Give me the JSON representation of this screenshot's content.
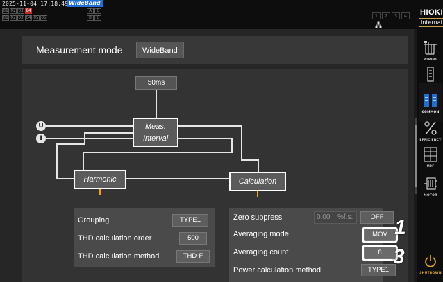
{
  "status_bar": {
    "datetime": "2025-11-04 17:18:49",
    "mode_badge": "WideBand",
    "indicators_row1": [
      "01",
      "02",
      "03",
      "04"
    ],
    "indicators_row2": [
      "01",
      "02",
      "03",
      "04",
      "05",
      "06"
    ],
    "ac_row1": [
      "A",
      "C"
    ],
    "ac_row2": [
      "D",
      "C"
    ],
    "channel_numbers": [
      "1",
      "2",
      "3",
      "4"
    ],
    "alert_color": "#c62828"
  },
  "sidebar": {
    "brand": "HIOKI",
    "source_label": "Internal",
    "items": [
      {
        "label": "WIRING",
        "icon": "wiring-icon"
      },
      {
        "label": "CHANNEL",
        "icon": "channel-icon"
      },
      {
        "label": "COMMON",
        "icon": "common-icon",
        "active": true
      },
      {
        "label": "EFFICIENCY",
        "icon": "efficiency-icon"
      },
      {
        "label": "UDF",
        "icon": "udf-icon"
      },
      {
        "label": "MOTOR",
        "icon": "motor-icon"
      },
      {
        "label": "SHUTDOWN",
        "icon": "shutdown-icon"
      }
    ]
  },
  "measurement_mode": {
    "label": "Measurement mode",
    "value": "WideBand"
  },
  "diagram": {
    "interval_value": "50ms",
    "meas_interval": [
      "Meas.",
      "Interval"
    ],
    "inputs": [
      "U",
      "I"
    ],
    "harmonic_label": "Harmonic",
    "calculation_label": "Calculation",
    "line_color": "#e6e6e6",
    "tick_color": "#f0a030"
  },
  "harmonic_settings": {
    "grouping": {
      "label": "Grouping",
      "value": "TYPE1"
    },
    "thd_order": {
      "label": "THD calculation order",
      "value": "500"
    },
    "thd_method": {
      "label": "THD calculation method",
      "value": "THD-F"
    }
  },
  "calculation_settings": {
    "zero_suppress": {
      "label": "Zero suppress",
      "value": "0.00",
      "unit": "%f.s.",
      "state": "OFF"
    },
    "averaging_mode": {
      "label": "Averaging mode",
      "value": "MOV"
    },
    "averaging_count": {
      "label": "Averaging count",
      "value": "8"
    },
    "power_method": {
      "label": "Power calculation method",
      "value": "TYPE1"
    }
  },
  "callouts": [
    "1",
    "3"
  ]
}
